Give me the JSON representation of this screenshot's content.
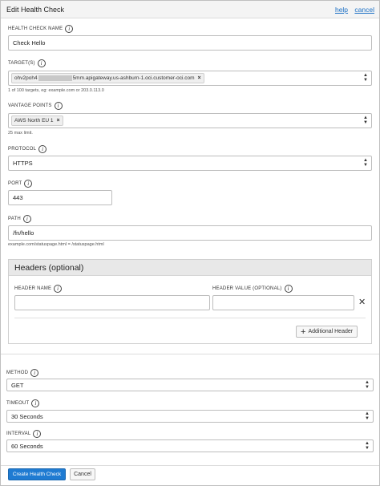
{
  "header": {
    "title": "Edit Health Check",
    "help": "help",
    "cancel": "cancel"
  },
  "health_check_name": {
    "label": "HEALTH CHECK NAME",
    "value": "Check Hello"
  },
  "targets": {
    "label": "TARGET(S)",
    "tag_prefix": "ohv2poh4",
    "tag_suffix": "5mm.apigateway.us-ashburn-1.oci.customer-oci.com",
    "hint": "1 of 100 targets, eg: example.com or 203.0.113.0"
  },
  "vantage_points": {
    "label": "VANTAGE POINTS",
    "tag": "AWS North EU 1",
    "hint": "25 max limit."
  },
  "protocol": {
    "label": "PROTOCOL",
    "value": "HTTPS"
  },
  "port": {
    "label": "PORT",
    "value": "443"
  },
  "path": {
    "label": "PATH",
    "value": "/fn/hello",
    "hint": "example.com/statuspage.html = /statuspage.html"
  },
  "headers": {
    "title": "Headers (optional)",
    "name_label": "HEADER NAME",
    "value_label": "HEADER VALUE (OPTIONAL)",
    "name_value": "",
    "value_value": "",
    "add_button": "Additional Header"
  },
  "method": {
    "label": "METHOD",
    "value": "GET"
  },
  "timeout": {
    "label": "TIMEOUT",
    "value": "30 Seconds"
  },
  "interval": {
    "label": "INTERVAL",
    "value": "60 Seconds"
  },
  "footer": {
    "submit": "Create Health Check",
    "cancel": "Cancel"
  },
  "icons": {
    "info": "info-icon",
    "remove": "close-icon",
    "add": "plus-icon",
    "select": "select-arrows-icon"
  }
}
